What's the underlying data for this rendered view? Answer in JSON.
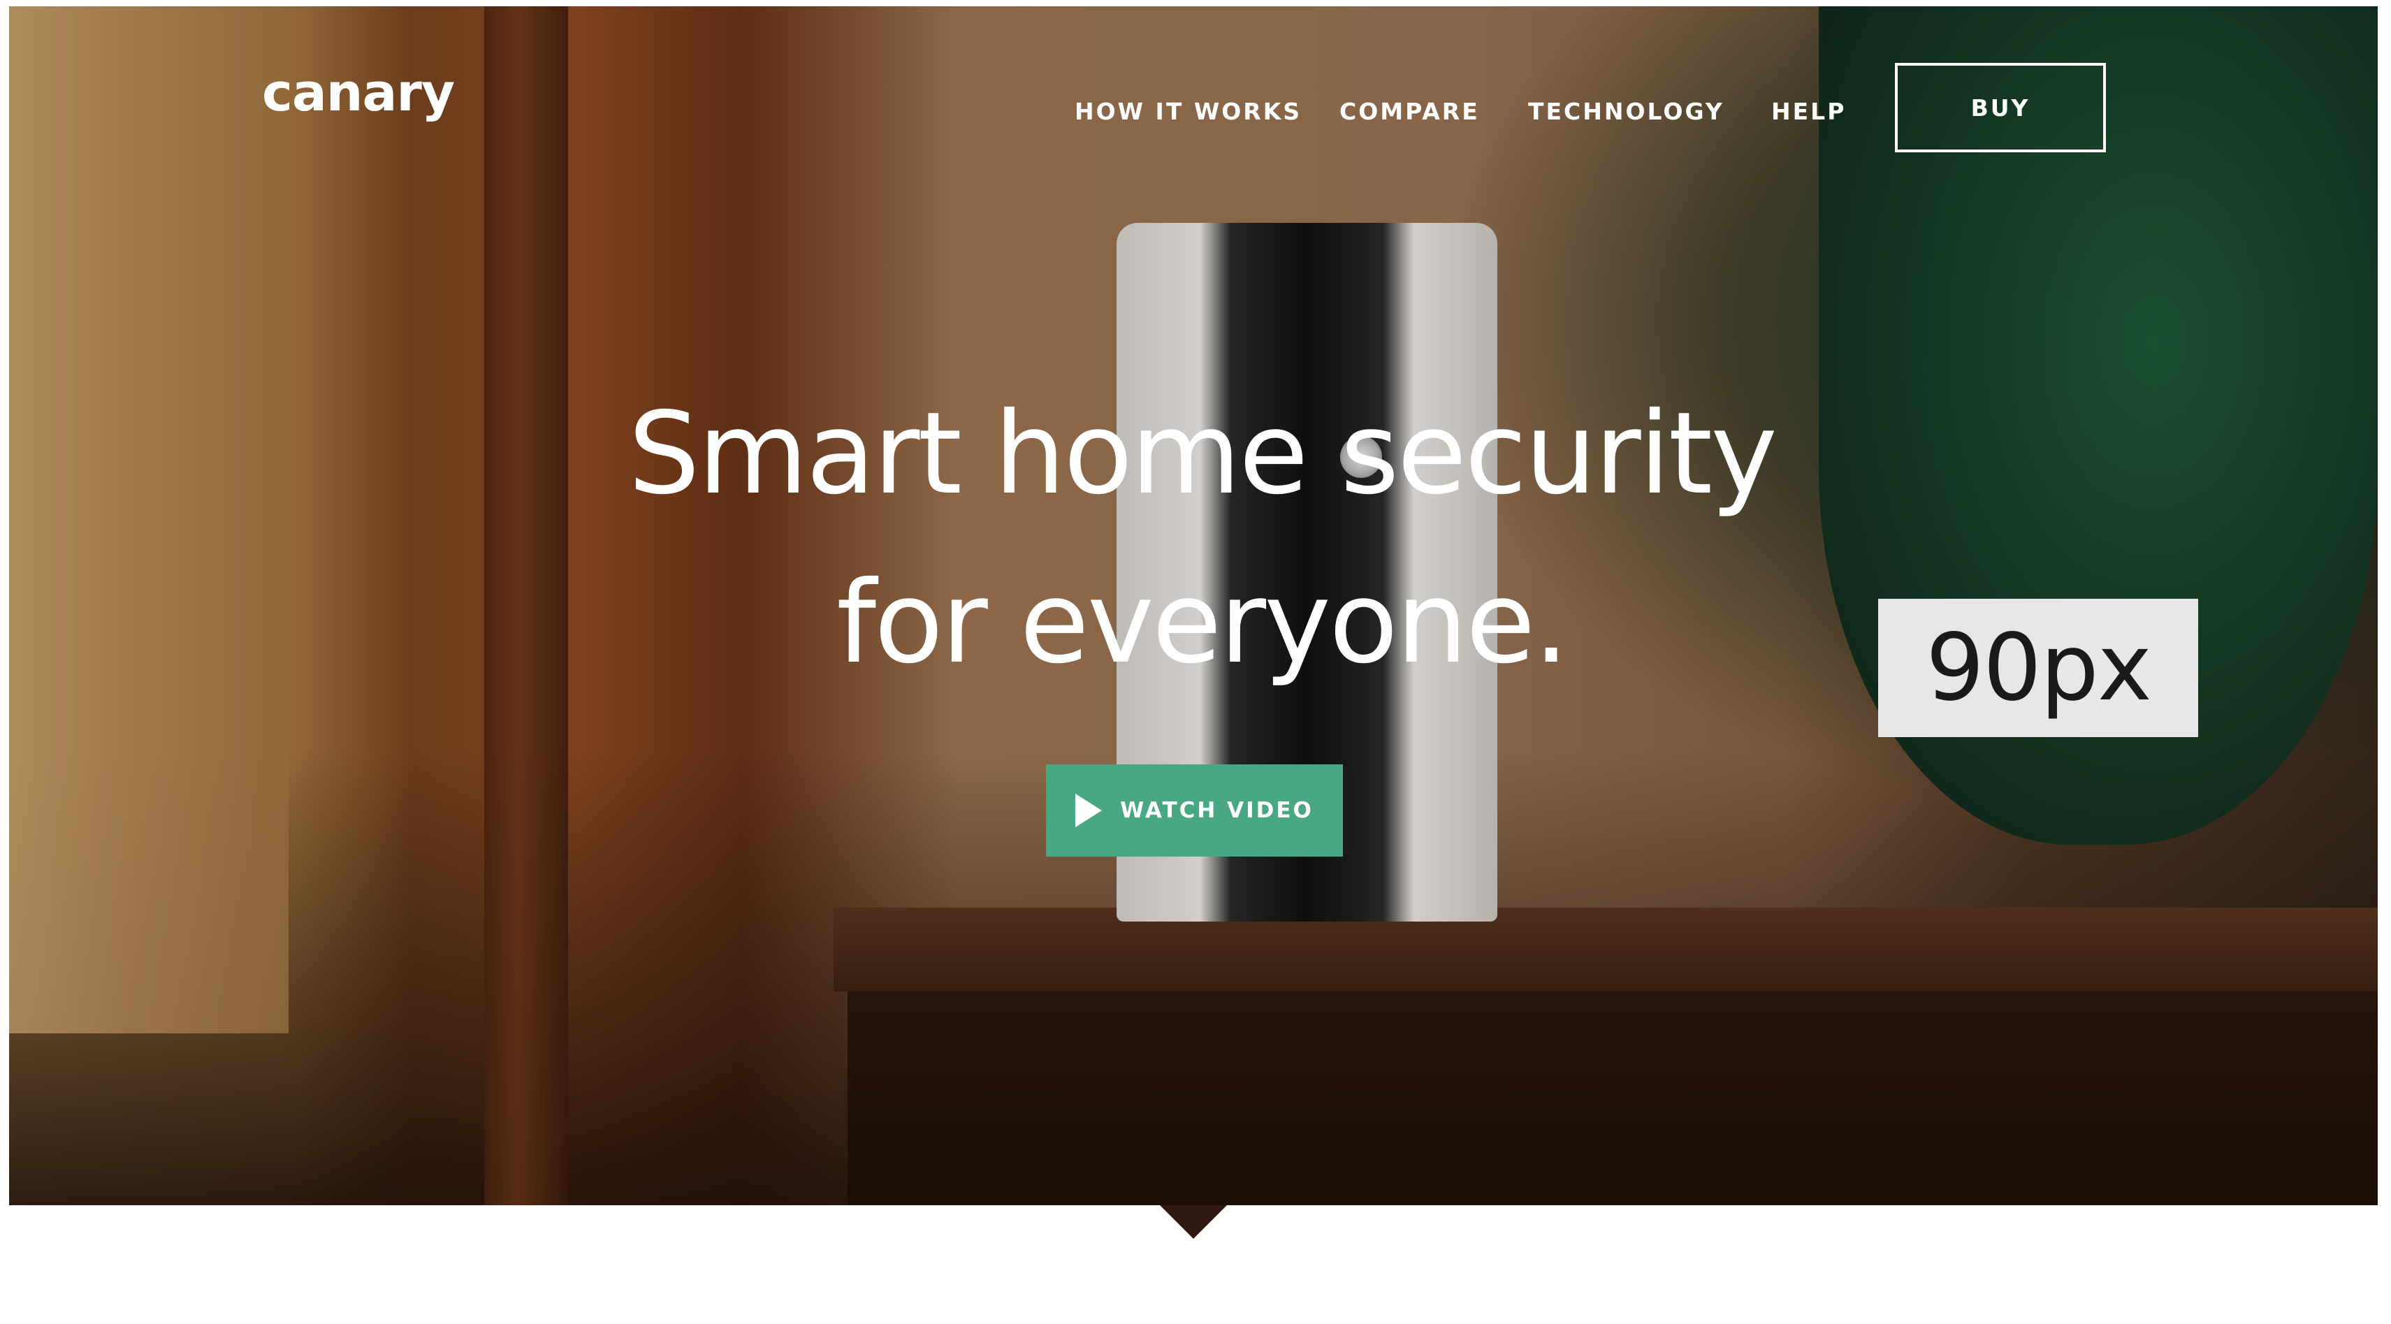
{
  "header": {
    "logo_text": "canary",
    "nav": [
      {
        "label": "HOW IT WORKS"
      },
      {
        "label": "COMPARE"
      },
      {
        "label": "TECHNOLOGY"
      },
      {
        "label": "HELP"
      }
    ],
    "buy_label": "BUY"
  },
  "hero": {
    "headline_line1": "Smart home security",
    "headline_line2": "for everyone.",
    "cta_label": "WATCH VIDEO",
    "cta_color": "#49a783",
    "cta_icon": "play-icon"
  },
  "annotation": {
    "size_label": "90px"
  }
}
